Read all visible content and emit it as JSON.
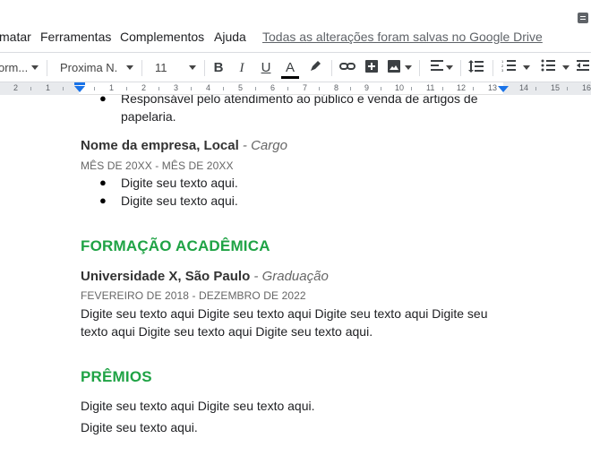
{
  "menu": {
    "items": [
      "matar",
      "Ferramentas",
      "Complementos",
      "Ajuda"
    ],
    "saved_status": "Todas as alterações foram salvas no Google Drive"
  },
  "toolbar": {
    "style_value": "orm...",
    "font_value": "Proxima N...",
    "size_value": "11",
    "bold": "B",
    "italic": "I",
    "underline": "U",
    "text_color": "A",
    "text_color_hex": "#000000"
  },
  "ruler": {
    "numbers": [
      "2",
      "1",
      "1",
      "2",
      "3",
      "4",
      "5",
      "6",
      "7",
      "8",
      "9",
      "10",
      "11",
      "12",
      "13",
      "14",
      "15",
      "16"
    ]
  },
  "document": {
    "prev_bullet_line1": "Responsável pelo atendimento ao público e venda de artigos de",
    "prev_bullet_line2": "papelaria.",
    "job": {
      "company": "Nome da empresa, Local",
      "separator": " - ",
      "role": "Cargo",
      "dates": "MÊS DE 20XX - MÊS DE 20XX",
      "bullets": [
        "Digite seu texto aqui.",
        "Digite seu texto aqui."
      ]
    },
    "education_heading": "FORMAÇÃO ACADÊMICA",
    "education": {
      "school": "Universidade X, São Paulo",
      "separator": " - ",
      "degree": "Graduação",
      "dates": "FEVEREIRO DE 2018 - DEZEMBRO DE 2022",
      "body_line1": "Digite seu texto aqui Digite seu texto aqui Digite seu texto aqui Digite seu",
      "body_line2": "texto aqui Digite seu texto aqui Digite seu texto aqui."
    },
    "awards_heading": "PRÊMIOS",
    "awards": {
      "line1": "Digite seu texto aqui Digite seu texto aqui.",
      "line2": "Digite seu texto aqui."
    }
  },
  "colors": {
    "heading_green": "#1fa345",
    "ruler_blue": "#1a73e8"
  }
}
